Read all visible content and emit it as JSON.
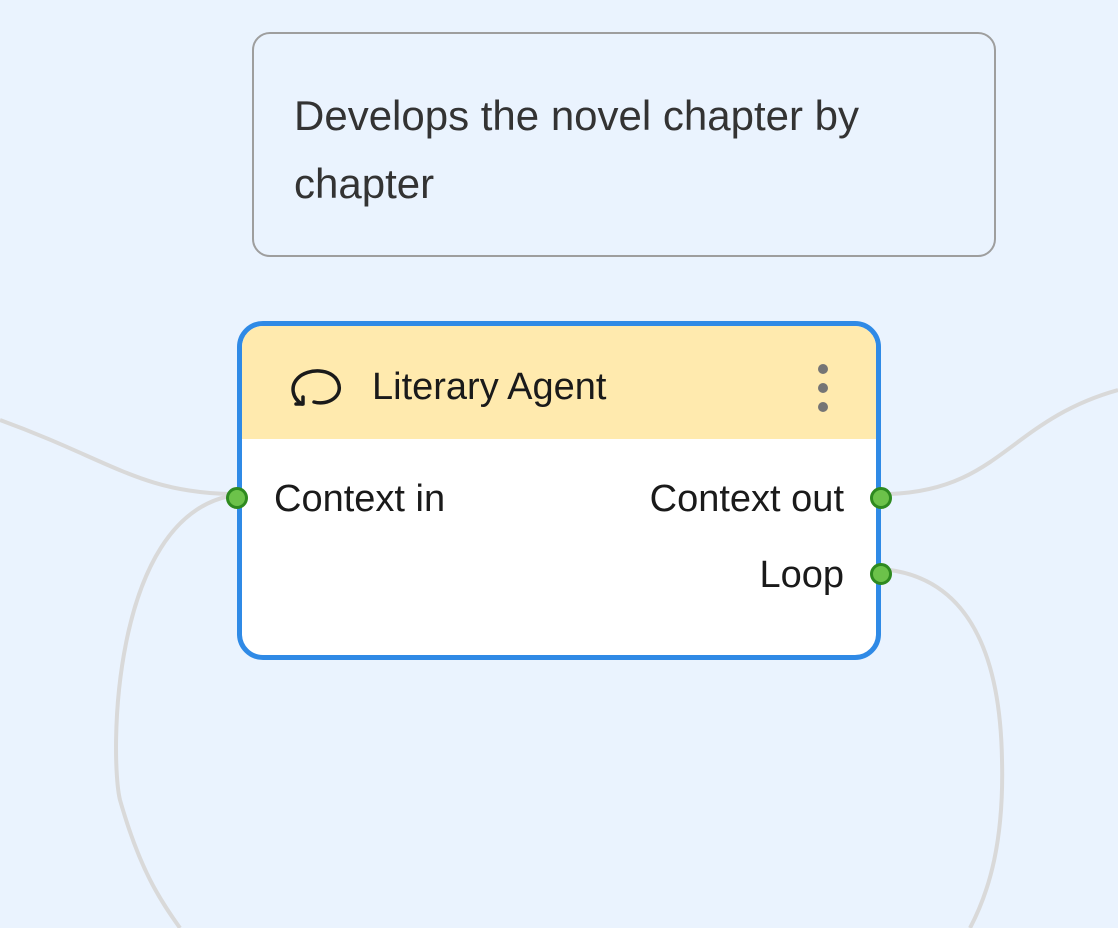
{
  "note": {
    "text": "Develops the novel chapter by chapter"
  },
  "node": {
    "title": "Literary Agent",
    "icon": "loop-icon",
    "menu_icon": "more-vertical-icon",
    "inputs": [
      {
        "label": "Context in"
      }
    ],
    "outputs": [
      {
        "label": "Context out"
      },
      {
        "label": "Loop"
      }
    ]
  },
  "colors": {
    "canvas_background": "#eaf3fe",
    "node_border_selected": "#2f8ae6",
    "node_header": "#ffeaae",
    "port": "#6cc24a",
    "edge": "#d9d9d9"
  }
}
